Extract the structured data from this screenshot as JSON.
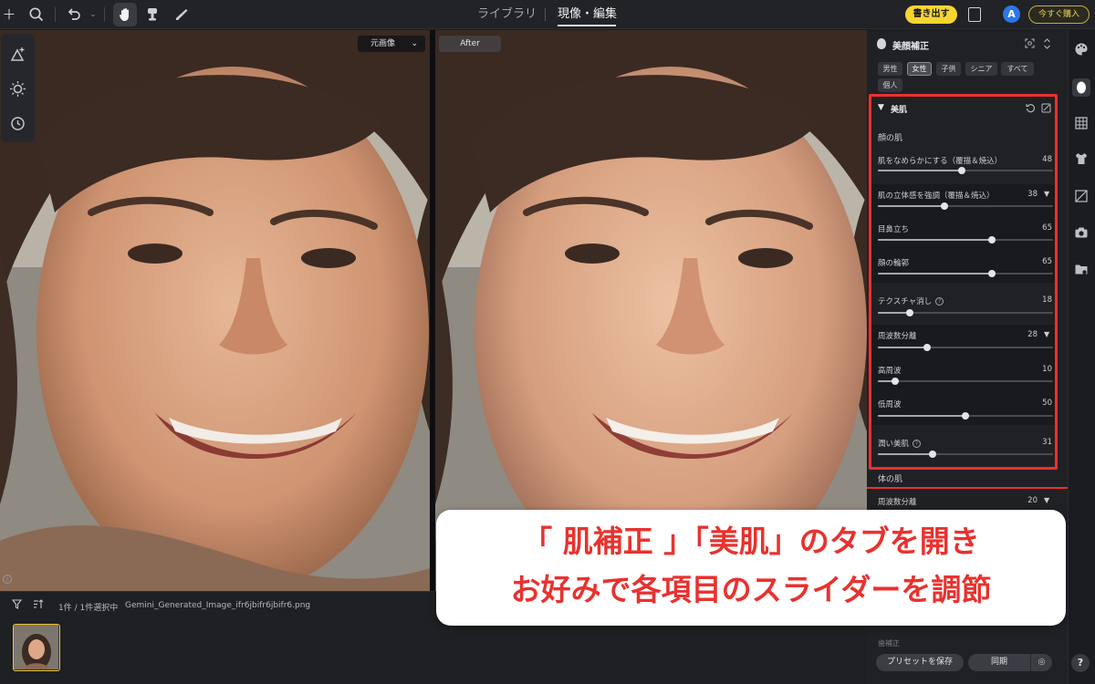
{
  "topbar": {
    "tabs": [
      {
        "label": "ライブラリ",
        "active": false
      },
      {
        "label": "現像・編集",
        "active": true
      }
    ],
    "export_label": "書き出す",
    "avatar_letter": "A",
    "buy_label": "今すぐ購入",
    "icons": [
      "plus-icon",
      "search-icon",
      "undo-icon",
      "hand-icon",
      "stamp-icon",
      "brush-icon",
      "compare-icon"
    ]
  },
  "viewer": {
    "before_dropdown": "元画像",
    "after_label": "After",
    "float_tools": [
      "triangle-plus-icon",
      "sun-icon",
      "history-icon"
    ]
  },
  "filmstrip": {
    "selection_text": "1件 / 1件選択中",
    "filename": "Gemini_Generated_Image_ifr6jbifr6jbifr6.png"
  },
  "panel": {
    "title": "美顔補正",
    "chips": [
      {
        "label": "男性",
        "active": false
      },
      {
        "label": "女性",
        "active": true
      },
      {
        "label": "子供",
        "active": false
      },
      {
        "label": "シニア",
        "active": false
      },
      {
        "label": "すべて",
        "active": false
      },
      {
        "label": "個人",
        "active": false
      }
    ],
    "section_title": "美肌",
    "face_group_label": "顔の肌",
    "body_group_label": "体の肌",
    "sliders": {
      "smooth": {
        "label": "肌をなめらかにする（覆描＆焼込）",
        "value": 48
      },
      "contour3d": {
        "label": "肌の立体感を強調（覆描＆焼込）",
        "value": 38
      },
      "nose": {
        "label": "目鼻立ち",
        "value": 65
      },
      "outline": {
        "label": "顔の輪郭",
        "value": 65
      },
      "texture": {
        "label": "テクスチャ消し",
        "value": 18
      },
      "freqsep": {
        "label": "周波数分離",
        "value": 28
      },
      "high": {
        "label": "高周波",
        "value": 10
      },
      "low": {
        "label": "低周波",
        "value": 50
      },
      "moist": {
        "label": "潤い美肌",
        "value": 31
      },
      "body_freq": {
        "label": "周波数分離",
        "value": 20
      }
    },
    "dim_label": "歯補正",
    "preset_button": "プリセットを保存",
    "sync_button": "同期"
  },
  "caption": {
    "line1": "「 肌補正 」「美肌」のタブを開き",
    "line2": "お好みで各項目のスライダーを調節"
  },
  "colors": {
    "accent_yellow": "#f6d531",
    "highlight_red": "#ee2f2f",
    "avatar_blue": "#2c77e8"
  }
}
